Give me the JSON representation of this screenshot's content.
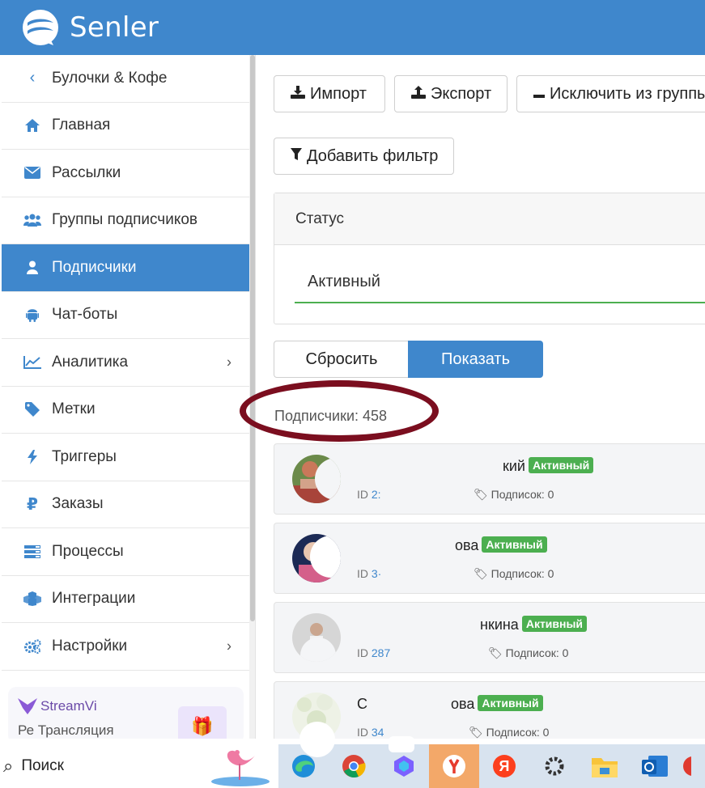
{
  "header": {
    "brand": "Senler"
  },
  "sidebar": {
    "back_label": "Булочки & Кофе",
    "items": [
      {
        "label": "Главная",
        "icon": "home-icon"
      },
      {
        "label": "Рассылки",
        "icon": "envelope-icon"
      },
      {
        "label": "Группы подписчиков",
        "icon": "users-icon"
      },
      {
        "label": "Подписчики",
        "icon": "user-icon",
        "active": true
      },
      {
        "label": "Чат-боты",
        "icon": "android-icon"
      },
      {
        "label": "Аналитика",
        "icon": "chart-line-icon",
        "has_submenu": true
      },
      {
        "label": "Метки",
        "icon": "tag-icon"
      },
      {
        "label": "Триггеры",
        "icon": "bolt-icon"
      },
      {
        "label": "Заказы",
        "icon": "ruble-icon"
      },
      {
        "label": "Процессы",
        "icon": "tasks-icon"
      },
      {
        "label": "Интеграции",
        "icon": "cubes-icon"
      },
      {
        "label": "Настройки",
        "icon": "cogs-icon",
        "has_submenu": true
      }
    ],
    "promo": {
      "title": "StreamVi",
      "subtitle": "Ре Трансляция"
    }
  },
  "toolbar": {
    "import_label": "Импорт",
    "export_label": "Экспорт",
    "exclude_label": "Исключить из группы",
    "add_filter_label": "Добавить фильтр"
  },
  "filter": {
    "heading": "Статус",
    "value": "Активный"
  },
  "actions": {
    "reset_label": "Сбросить",
    "show_label": "Показать"
  },
  "subscribers": {
    "count_label": "Подписчики: 458",
    "items": [
      {
        "name": "кий",
        "status": "Активный",
        "id_prefix": "ID",
        "id": "2:",
        "subs": "Подписок: 0"
      },
      {
        "name": "ова",
        "status": "Активный",
        "id_prefix": "ID",
        "id": "3·",
        "subs": "Подписок: 0"
      },
      {
        "name": "нкина",
        "status": "Активный",
        "id_prefix": "ID",
        "id": "287",
        "subs": "Подписок: 0"
      },
      {
        "name": "С ова",
        "status": "Активный",
        "id_prefix": "ID",
        "id": "34",
        "subs": "Подписок: 0"
      }
    ]
  },
  "taskbar": {
    "search_label": "Поиск",
    "apps": [
      "edge-icon",
      "chrome-icon",
      "copilot-icon",
      "yandex-browser-icon",
      "yandex-icon",
      "settings-icon",
      "file-explorer-icon",
      "outlook-icon",
      "app-icon"
    ]
  },
  "colors": {
    "accent": "#3f87cc",
    "badge": "#4caf50",
    "annotation": "#7b0e1f"
  }
}
